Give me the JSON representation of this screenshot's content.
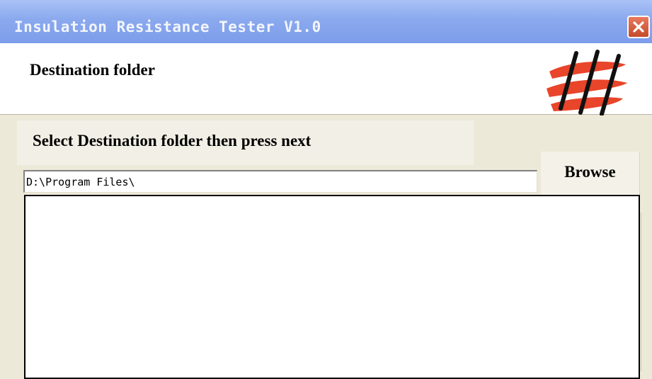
{
  "window": {
    "title": "Insulation Resistance Tester V1.0",
    "close_icon": "close-icon",
    "colors": {
      "titlebar": "#8aa9ee",
      "close_button": "#d55c3e",
      "logo_red": "#e8452a"
    }
  },
  "header": {
    "title": "Destination folder",
    "logo_icon": "brand-logo-icon"
  },
  "instruction": {
    "text": "Select Destination folder then press next"
  },
  "folder": {
    "path": "D:\\Program Files\\",
    "browse_label": "Browse"
  },
  "folder_tree": {
    "items": []
  }
}
